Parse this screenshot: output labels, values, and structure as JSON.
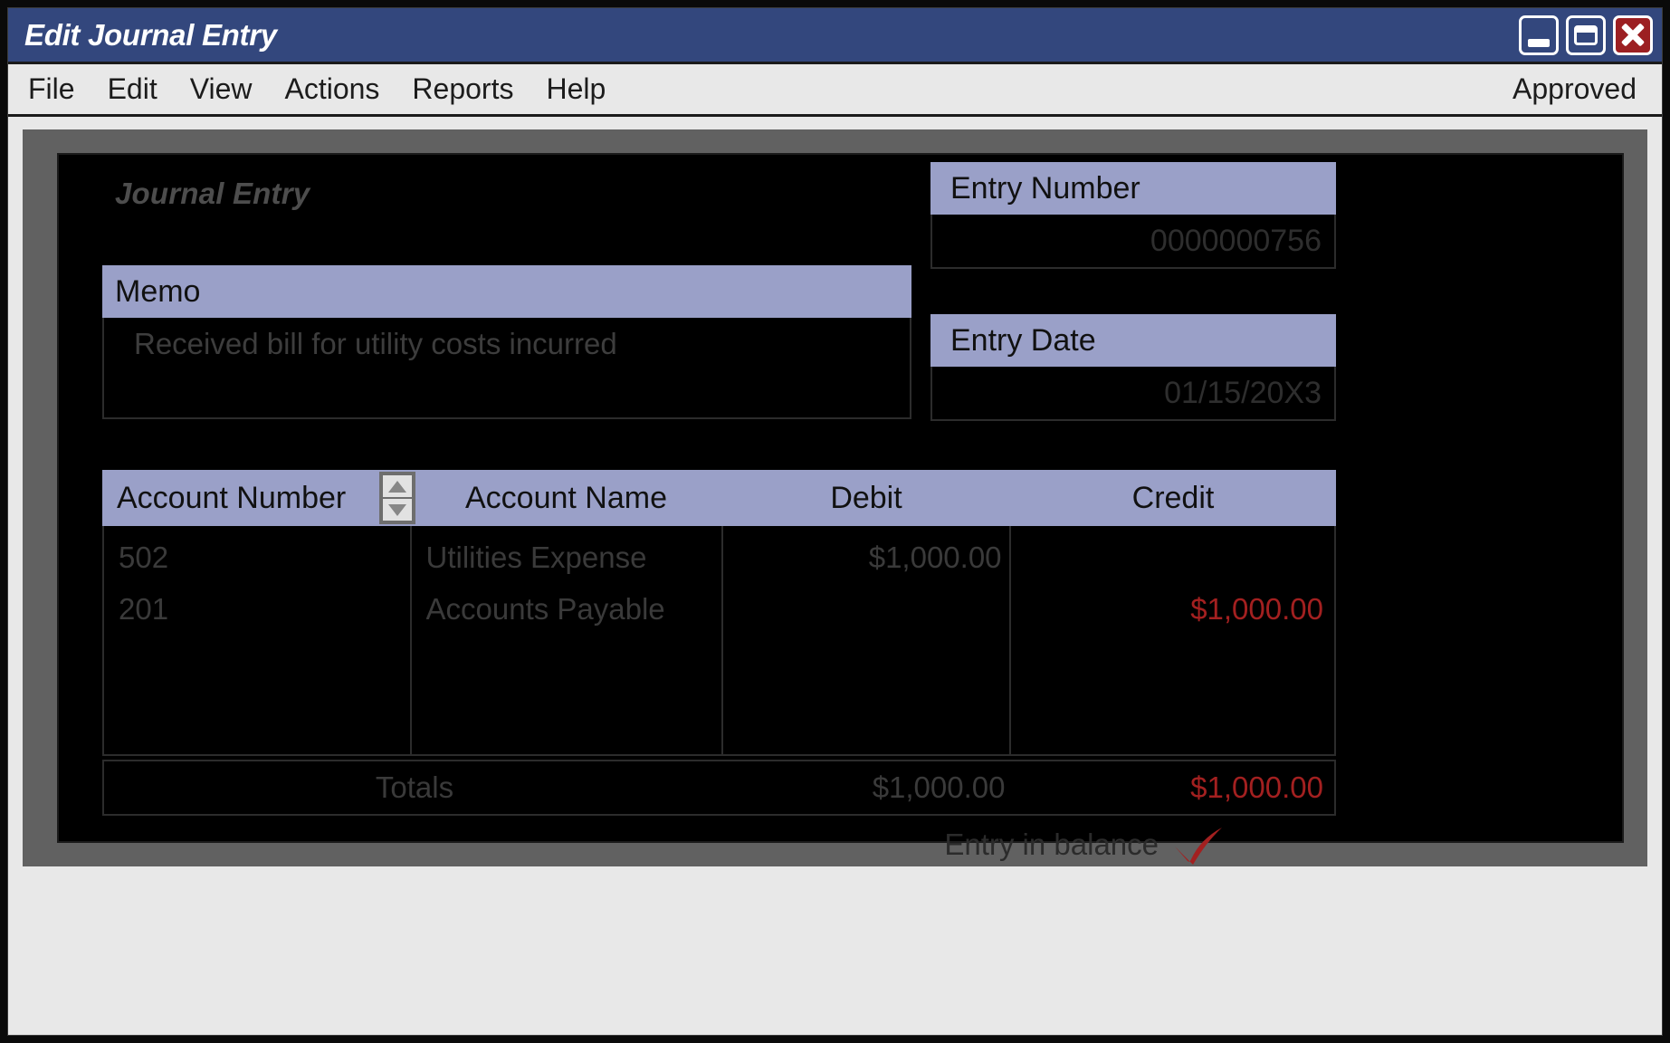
{
  "window": {
    "title": "Edit Journal Entry",
    "controls": [
      {
        "name": "minimize",
        "label": "Minimize"
      },
      {
        "name": "maximize",
        "label": "Maximize"
      },
      {
        "name": "close",
        "label": "Close"
      }
    ]
  },
  "menubar": {
    "items": [
      "File",
      "Edit",
      "View",
      "Actions",
      "Reports",
      "Help"
    ],
    "status": "Approved"
  },
  "form": {
    "title": "Journal Entry",
    "memo": {
      "label": "Memo",
      "value": "Received bill for utility costs incurred"
    },
    "entry_number": {
      "label": "Entry Number",
      "value": "0000000756"
    },
    "entry_date": {
      "label": "Entry Date",
      "value": "01/15/20X3"
    }
  },
  "table": {
    "columns": [
      "Account Number",
      "Account Name",
      "Debit",
      "Credit"
    ],
    "rows": [
      {
        "account_number": "502",
        "account_name": "Utilities Expense",
        "debit": "$1,000.00",
        "credit": ""
      },
      {
        "account_number": "201",
        "account_name": "Accounts Payable",
        "debit": "",
        "credit": "$1,000.00"
      },
      {
        "account_number": "",
        "account_name": "",
        "debit": "",
        "credit": ""
      },
      {
        "account_number": "",
        "account_name": "",
        "debit": "",
        "credit": ""
      }
    ],
    "totals": {
      "label": "Totals",
      "debit": "$1,000.00",
      "credit": "$1,000.00"
    },
    "balance_message": "Entry in balance"
  },
  "colors": {
    "titlebar": "#33477d",
    "close_button": "#9c1f22",
    "header_lavender": "#9aa0c8",
    "credit_red": "#a32020",
    "panel_background": "#000000",
    "frame_gray": "#616161",
    "chrome_gray": "#e8e8e8"
  }
}
